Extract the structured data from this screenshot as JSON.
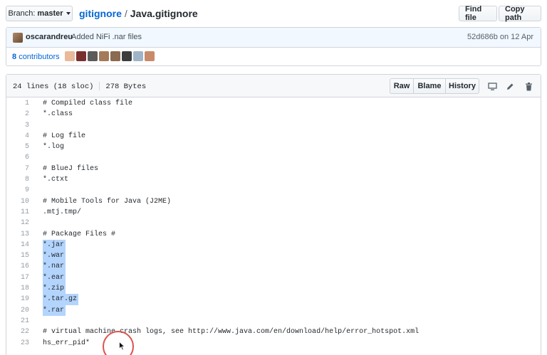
{
  "branch": {
    "prefix": "Branch:",
    "name": "master"
  },
  "path": {
    "repo": "gitignore",
    "separator": "/",
    "file": "Java.gitignore"
  },
  "top_buttons": {
    "find_file": "Find file",
    "copy_path": "Copy path"
  },
  "commit": {
    "author": "oscarandreu",
    "message": "Added NiFi .nar files",
    "meta": "52d686b on 12 Apr"
  },
  "contributors": {
    "count": "8",
    "label": "contributors"
  },
  "file_info": {
    "lines": "24 lines (18 sloc)",
    "size": "278 Bytes"
  },
  "file_buttons": {
    "raw": "Raw",
    "blame": "Blame",
    "history": "History"
  },
  "code_lines": [
    {
      "n": "1",
      "text": "# Compiled class file",
      "hl": false
    },
    {
      "n": "2",
      "text": "*.class",
      "hl": false
    },
    {
      "n": "3",
      "text": "",
      "hl": false
    },
    {
      "n": "4",
      "text": "# Log file",
      "hl": false
    },
    {
      "n": "5",
      "text": "*.log",
      "hl": false
    },
    {
      "n": "6",
      "text": "",
      "hl": false
    },
    {
      "n": "7",
      "text": "# BlueJ files",
      "hl": false
    },
    {
      "n": "8",
      "text": "*.ctxt",
      "hl": false
    },
    {
      "n": "9",
      "text": "",
      "hl": false
    },
    {
      "n": "10",
      "text": "# Mobile Tools for Java (J2ME)",
      "hl": false
    },
    {
      "n": "11",
      "text": ".mtj.tmp/",
      "hl": false
    },
    {
      "n": "12",
      "text": "",
      "hl": false
    },
    {
      "n": "13",
      "text": "# Package Files #",
      "hl": false
    },
    {
      "n": "14",
      "text": "*.jar",
      "hl": true
    },
    {
      "n": "15",
      "text": "*.war",
      "hl": true
    },
    {
      "n": "16",
      "text": "*.nar",
      "hl": true
    },
    {
      "n": "17",
      "text": "*.ear",
      "hl": true
    },
    {
      "n": "18",
      "text": "*.zip",
      "hl": true
    },
    {
      "n": "19",
      "text": "*.tar.gz",
      "hl": true
    },
    {
      "n": "20",
      "text": "*.rar",
      "hl": true
    },
    {
      "n": "21",
      "text": "",
      "hl": false
    },
    {
      "n": "22",
      "text": "# virtual machine crash logs, see http://www.java.com/en/download/help/error_hotspot.xml",
      "hl": false
    },
    {
      "n": "23",
      "text": "hs_err_pid*",
      "hl": false
    }
  ],
  "colors": {
    "link": "#0366d6",
    "highlight": "#b3d4fc",
    "cursor_ring": "#d9534f"
  }
}
